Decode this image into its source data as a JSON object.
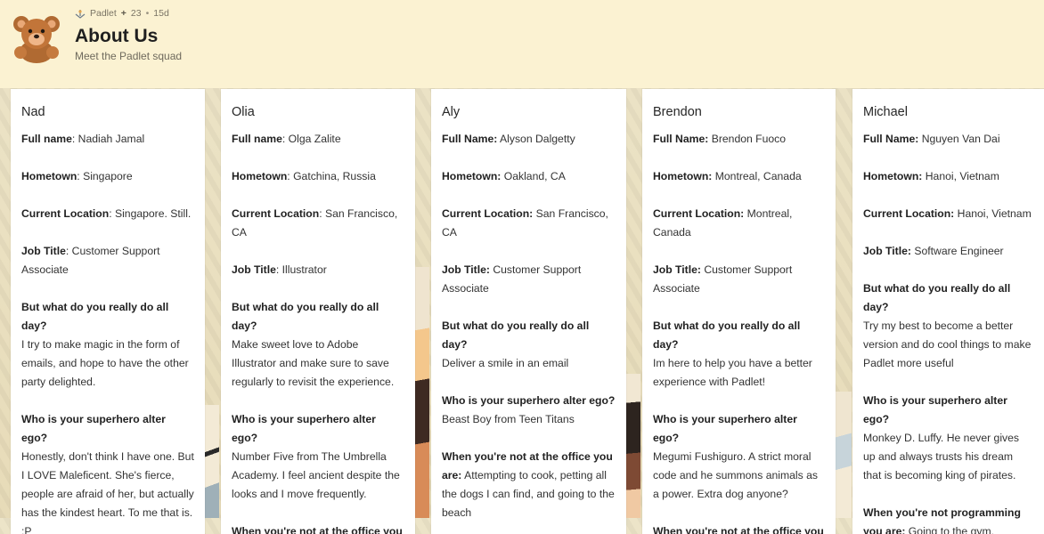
{
  "header": {
    "meta": {
      "app_name": "Padlet",
      "plus": "+",
      "count": "23",
      "separator": "•",
      "age": "15d"
    },
    "title": "About Us",
    "subtitle": "Meet the Padlet squad",
    "icons": {
      "avatar": "teddy-bear-icon",
      "padlet_logo": "padlet-logo-icon"
    }
  },
  "cards": [
    {
      "name": "Nad",
      "full_name_label": "Full name",
      "full_name": ": Nadiah Jamal",
      "hometown_label": "Hometown",
      "hometown": ": Singapore",
      "location_label": "Current Location",
      "location": ": Singapore. Still.",
      "job_label": "Job Title",
      "job": ": Customer Support Associate",
      "day_label": "But what do you really do all day?",
      "day": "I try to make magic in the form of emails, and hope to have the other party delighted.",
      "hero_label": "Who is your superhero alter ego?",
      "hero": "Honestly, don't think I have one. But I LOVE Maleficent. She's fierce, people are afraid of her, but actually has the kindest heart. To me that is. :P"
    },
    {
      "name": "Olia",
      "full_name_label": "Full name",
      "full_name": ": Olga Zalite",
      "hometown_label": "Hometown",
      "hometown": ": Gatchina, Russia",
      "location_label": "Current Location",
      "location": ": San Francisco, CA",
      "job_label": "Job Title",
      "job": ": Illustrator",
      "day_label": "But what do you really do all day?",
      "day": "Make sweet love to Adobe Illustrator and make sure to save regularly to revisit the experience.",
      "hero_label": "Who is your superhero alter ego?",
      "hero": "Number Five from The Umbrella Academy. I feel ancient despite the looks and I move frequently.",
      "office_label": "When you're not at the office you"
    },
    {
      "name": "Aly",
      "full_name_label": "Full Name:",
      "full_name": "  Alyson Dalgetty",
      "hometown_label": "Hometown:",
      "hometown": "  Oakland, CA",
      "location_label": "Current Location:",
      "location": "  San Francisco, CA",
      "job_label": " Job Title:",
      "job": "  Customer Support Associate",
      "day_label": "But what do you really do all day?",
      "day": "Deliver a smile in an email",
      "hero_label": "Who is your superhero alter ego?",
      "hero": "Beast Boy from Teen Titans",
      "office_label": "When you're not at the office you are:",
      "office": " Attempting to cook, petting all the dogs I can find, and going to the beach"
    },
    {
      "name": "Brendon",
      "full_name_label": "Full Name:",
      "full_name": " Brendon Fuoco",
      "hometown_label": "Hometown:",
      "hometown": " Montreal, Canada",
      "location_label": "Current Location:",
      "location": "  Montreal, Canada",
      "job_label": "Job Title:",
      "job": " Customer Support Associate",
      "day_label": "But what do you really do all day?",
      "day": "Im here to help you have a better experience with Padlet!",
      "hero_label": "Who is your superhero alter ego?",
      "hero": "Megumi Fushiguro. A strict moral code and he summons animals as a power. Extra dog anyone?",
      "office_label": "When you're not at the office you"
    },
    {
      "name": "Michael",
      "full_name_label": "Full Name:",
      "full_name": " Nguyen Van Dai",
      "hometown_label": "Hometown:",
      "hometown": " Hanoi, Vietnam",
      "location_label": "Current Location:",
      "location": " Hanoi, Vietnam",
      "job_label": "Job Title:",
      "job": " Software Engineer",
      "day_label": "But what do you really do all day?",
      "day": "Try my best to become a better version and do cool things to make Padlet more useful",
      "hero_label": "Who is your superhero alter ego?",
      "hero": "Monkey D. Luffy. He never gives up and always trusts his dream that is becoming king of pirates.",
      "office_label": "When you're not programming you are:",
      "office": " Going to the gym,"
    }
  ],
  "colors": {
    "header_bg": "#fbf2d2",
    "card_bg": "#ffffff",
    "text": "#333333"
  }
}
